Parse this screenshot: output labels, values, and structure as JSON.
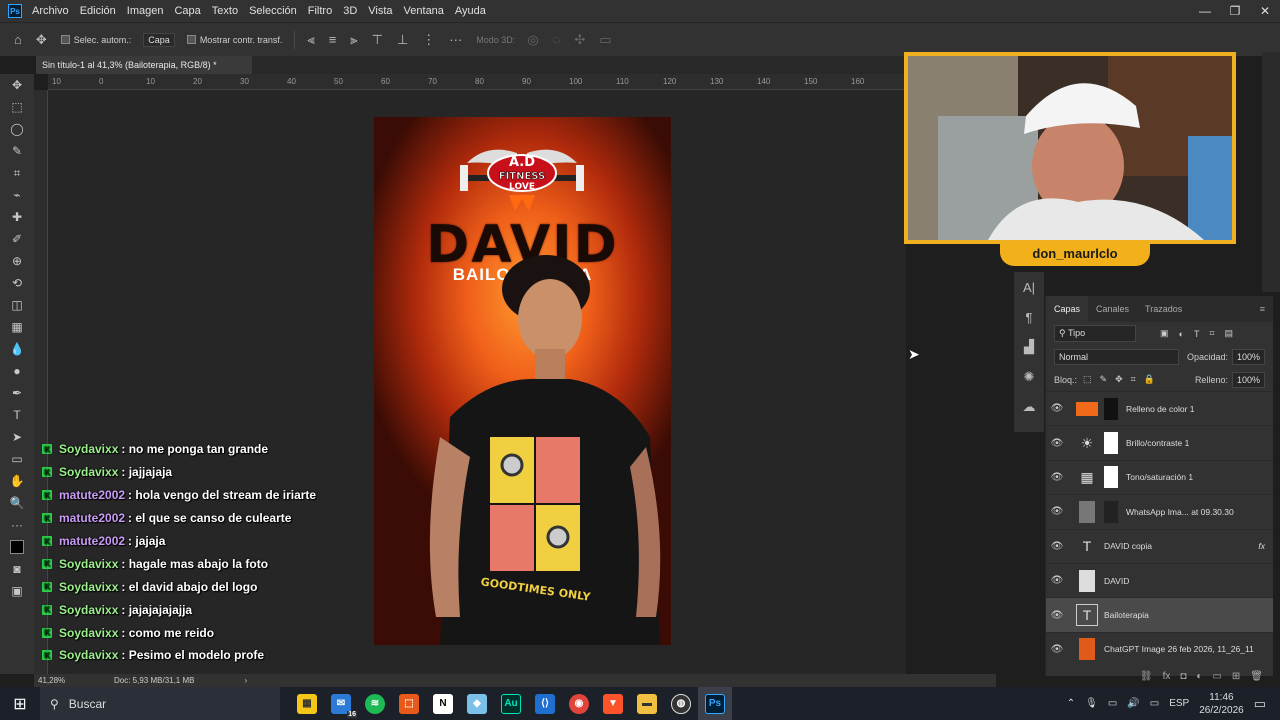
{
  "app": {
    "menus": [
      "Archivo",
      "Edición",
      "Imagen",
      "Capa",
      "Texto",
      "Selección",
      "Filtro",
      "3D",
      "Vista",
      "Ventana",
      "Ayuda"
    ],
    "logo_text": "Ps"
  },
  "options": {
    "auto_select_label": "Selec. autom.:",
    "auto_select_value": "Capa",
    "show_transform_label": "Mostrar contr. transf.",
    "mode_3d": "Modo 3D:"
  },
  "document": {
    "tab_title": "Sin título-1 al 41,3% (Bailoterapia, RGB/8) *",
    "zoom": "41,28%",
    "doc_size": "Doc: 5,93 MB/31,1 MB",
    "ruler_numbers": [
      "10",
      "0",
      "10",
      "20",
      "30",
      "40",
      "50",
      "60",
      "70",
      "80",
      "90",
      "100",
      "110",
      "120",
      "130",
      "140",
      "150",
      "160"
    ]
  },
  "artwork": {
    "logo_line1": "A.D",
    "logo_line2": "FITNESS",
    "logo_line3": "LOVE",
    "title": "DAVID",
    "subtitle": "BAILOTERAPIA",
    "shirt_text": "GOODTIMES ONLY"
  },
  "chat": [
    {
      "user": "Soydavixx",
      "text": ": no me ponga tan grande",
      "color": "#9cf08c"
    },
    {
      "user": "Soydavixx",
      "text": ": jajjajaja",
      "color": "#9cf08c"
    },
    {
      "user": "matute2002",
      "text": ": hola vengo del stream de iriarte",
      "color": "#c89cf5"
    },
    {
      "user": "matute2002",
      "text": ": el que se canso de culearte",
      "color": "#c89cf5"
    },
    {
      "user": "matute2002",
      "text": ": jajaja",
      "color": "#c89cf5"
    },
    {
      "user": "Soydavixx",
      "text": ": hagale mas abajo la foto",
      "color": "#9cf08c"
    },
    {
      "user": "Soydavixx",
      "text": ": el david abajo del logo",
      "color": "#9cf08c"
    },
    {
      "user": "Soydavixx",
      "text": ": jajajajajajja",
      "color": "#9cf08c"
    },
    {
      "user": "Soydavixx",
      "text": ": como me reido",
      "color": "#9cf08c"
    },
    {
      "user": "Soydavixx",
      "text": ": Pesimo el modelo profe",
      "color": "#9cf08c"
    }
  ],
  "webcam": {
    "streamer_name": "don_maurlclo"
  },
  "layers_panel": {
    "tabs": [
      "Capas",
      "Canales",
      "Trazados"
    ],
    "filter": "Tipo",
    "blend_mode": "Normal",
    "opacity_label": "Opacidad:",
    "opacity_value": "100%",
    "lock_label": "Bloq.:",
    "fill_label": "Relleno:",
    "fill_value": "100%",
    "layers": [
      {
        "name": "Relleno de color 1",
        "thumb": "color-fill"
      },
      {
        "name": "Brillo/contraste 1",
        "thumb": "brightness"
      },
      {
        "name": "Tono/saturación 1",
        "thumb": "hue-sat"
      },
      {
        "name": "WhatsApp Ima... at 09.30.30",
        "thumb": "photo"
      },
      {
        "name": "DAVID copia",
        "thumb": "text"
      },
      {
        "name": "DAVID",
        "thumb": "doc"
      },
      {
        "name": "Bailoterapia",
        "thumb": "text"
      },
      {
        "name": "ChatGPT Image 26 feb 2026, 11_26_11",
        "thumb": "image"
      }
    ]
  },
  "taskbar": {
    "search_placeholder": "Buscar",
    "lang": "ESP",
    "time": "11:46",
    "date": "26/2/2026",
    "badge": "16"
  },
  "colors": {
    "accent_orange": "#f0b020",
    "chat_green_user": "#9cf08c",
    "chat_purple_user": "#c89cf5",
    "ps_blue": "#31a8ff"
  }
}
